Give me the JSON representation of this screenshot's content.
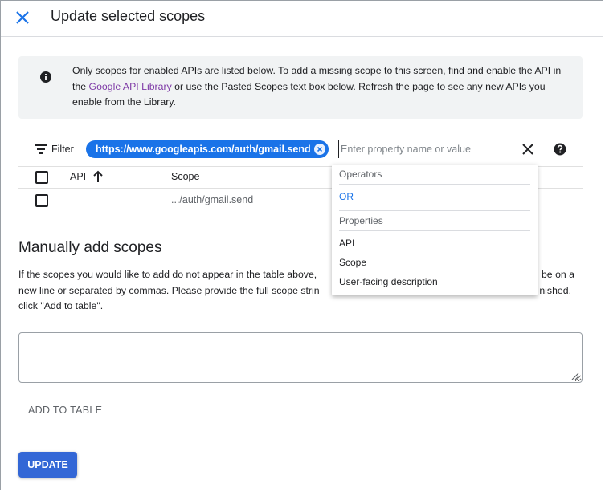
{
  "dialog": {
    "title": "Update selected scopes"
  },
  "banner": {
    "text_before": "Only scopes for enabled APIs are listed below. To add a missing scope to this screen, find and enable the API in the ",
    "link": "Google API Library",
    "text_after": " or use the Pasted Scopes text box below. Refresh the page to see any new APIs you enable from the Library."
  },
  "filter": {
    "label": "Filter",
    "chip": "https://www.googleapis.com/auth/gmail.send",
    "placeholder": "Enter property name or value"
  },
  "table": {
    "headers": {
      "api": "API",
      "scope": "Scope"
    },
    "rows": [
      {
        "api": "",
        "scope": ".../auth/gmail.send"
      }
    ]
  },
  "dropdown": {
    "operators_header": "Operators",
    "operators": [
      "OR"
    ],
    "properties_header": "Properties",
    "properties": [
      "API",
      "Scope",
      "User-facing description"
    ]
  },
  "manual": {
    "title": "Manually add scopes",
    "desc_line1": "If the scopes you would like to add do not appear in the table above,",
    "desc_line1_right": "ld be on a",
    "desc_line2": "new line or separated by commas. Please provide the full scope strin",
    "desc_line2_right": "nished,",
    "desc_line3": "click \"Add to table\".",
    "add_button": "ADD TO TABLE"
  },
  "footer": {
    "update_button": "UPDATE"
  },
  "colors": {
    "accent": "#1a73e8",
    "update_button": "#3367d6",
    "link": "#7e3aa6",
    "banner_bg": "#f1f3f4"
  }
}
